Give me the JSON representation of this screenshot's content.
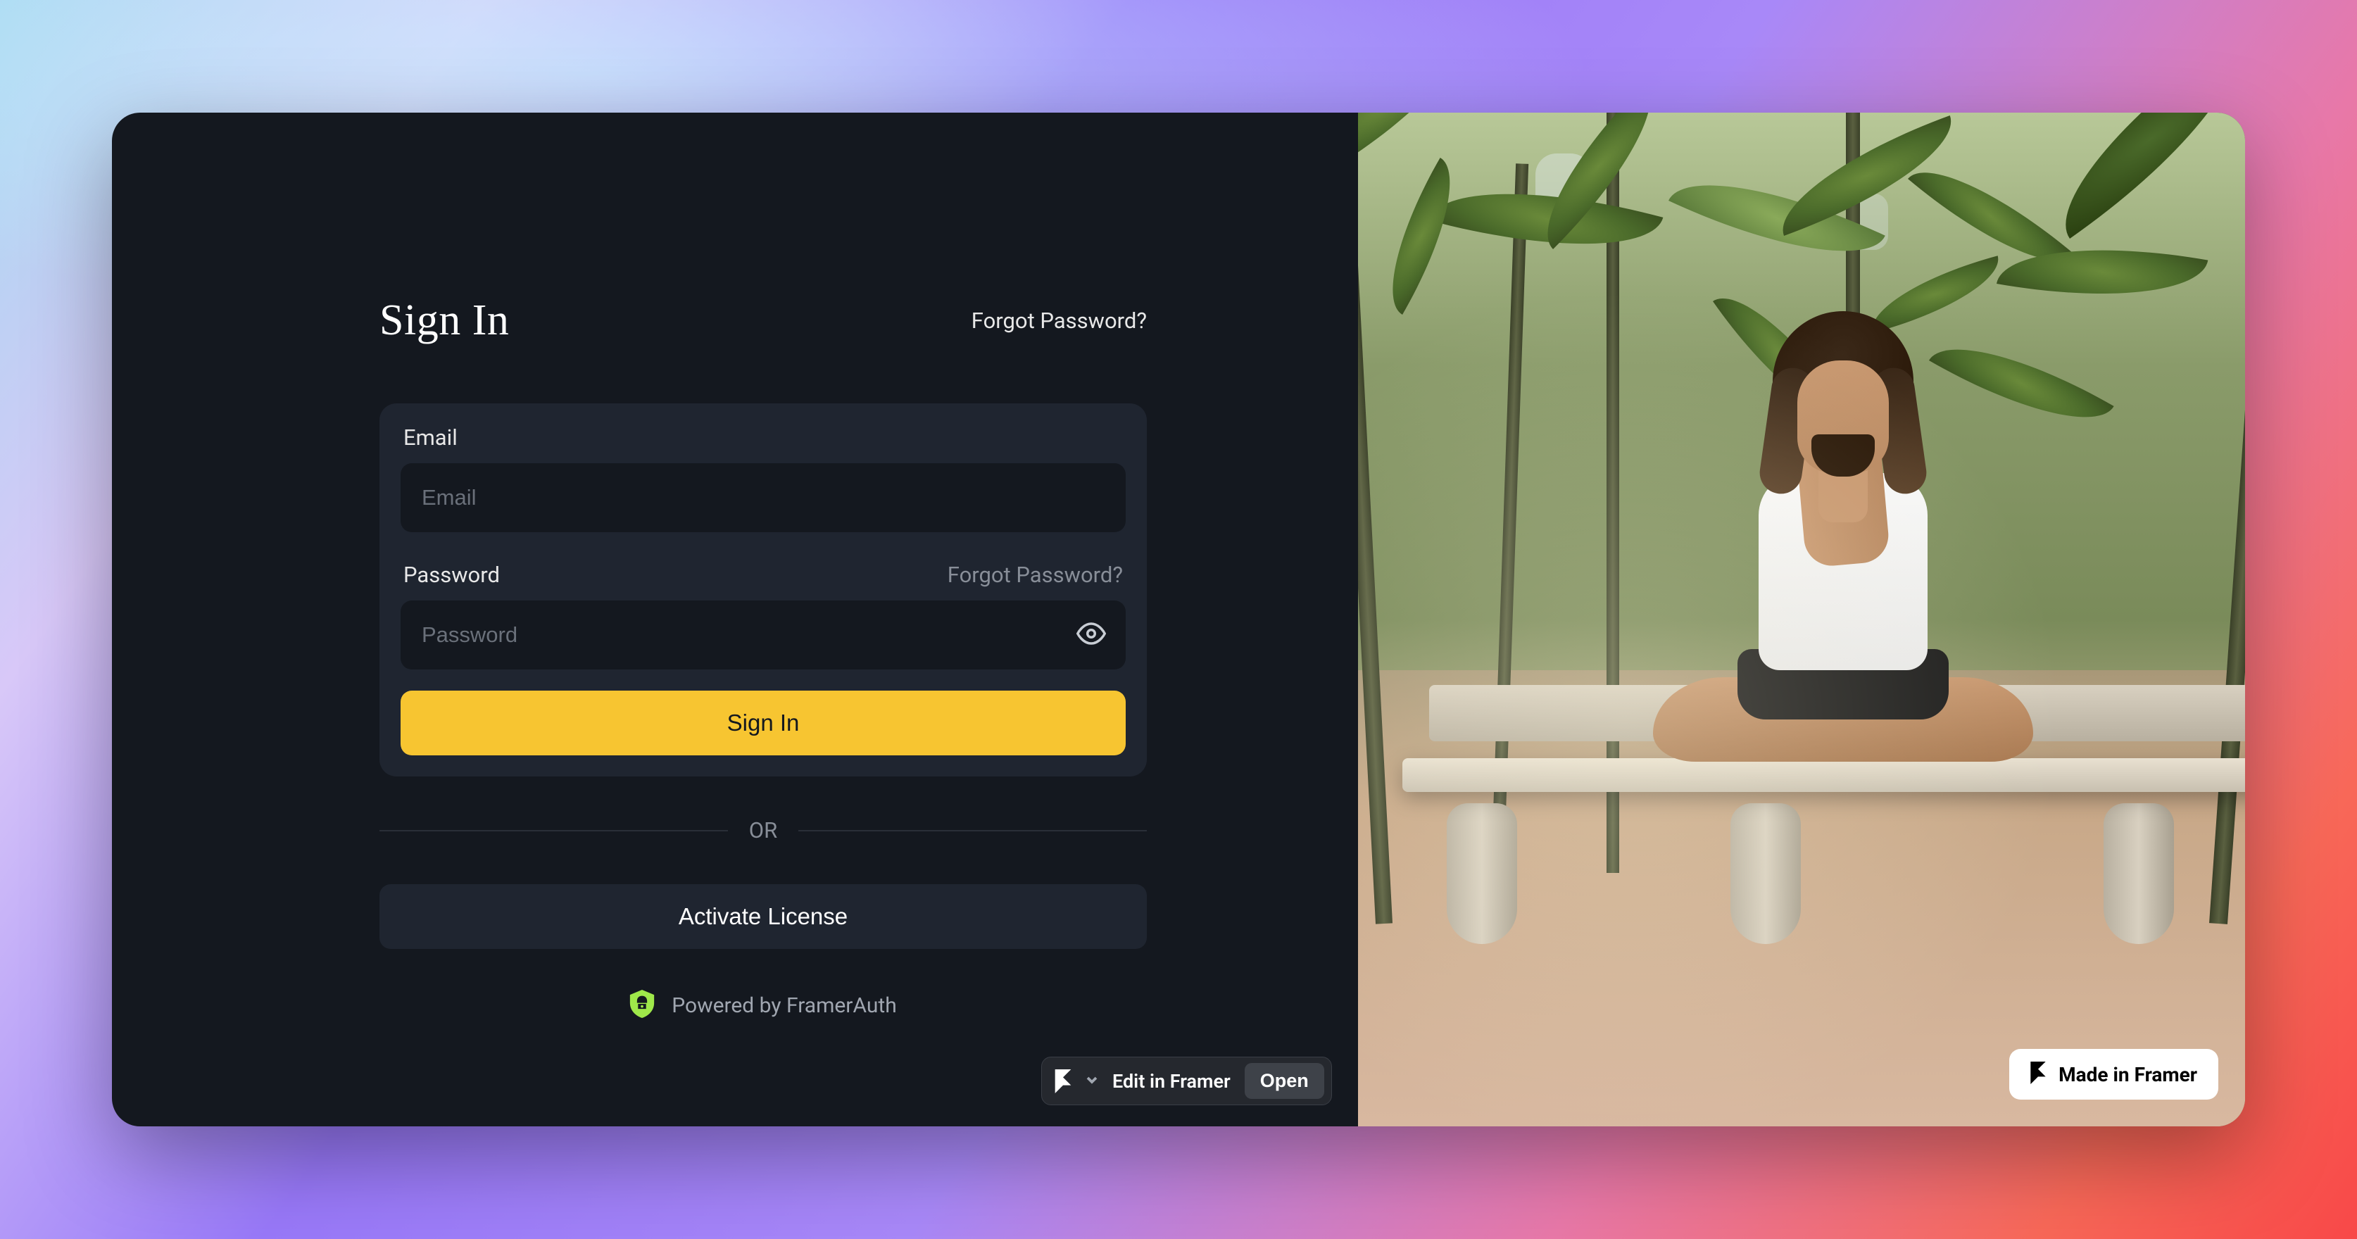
{
  "header": {
    "title": "Sign In",
    "forgot_link": "Forgot Password?"
  },
  "form": {
    "email_label": "Email",
    "email_placeholder": "Email",
    "password_label": "Password",
    "password_placeholder": "Password",
    "forgot_inline": "Forgot Password?",
    "submit_label": "Sign In"
  },
  "divider": {
    "text": "OR"
  },
  "secondary": {
    "activate_label": "Activate License"
  },
  "powered": {
    "text": "Powered by FramerAuth"
  },
  "editor_badge": {
    "edit_label": "Edit in Framer",
    "open_label": "Open"
  },
  "made_badge": {
    "text": "Made in Framer"
  }
}
